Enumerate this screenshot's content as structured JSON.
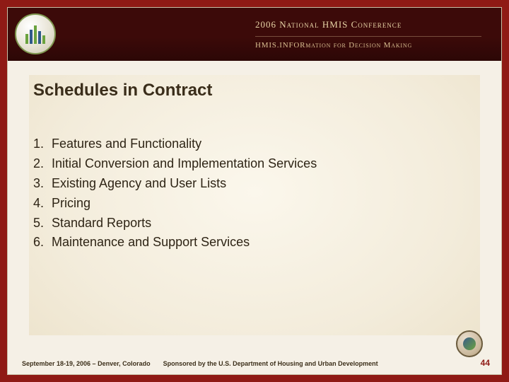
{
  "header": {
    "line1": "2006 National HMIS Conference",
    "line2": "HMIS.INFORmation for Decision Making"
  },
  "title": "Schedules in Contract",
  "items": [
    "Features and Functionality",
    "Initial Conversion and Implementation Services",
    "Existing Agency and User Lists",
    "Pricing",
    "Standard Reports",
    "Maintenance and Support Services"
  ],
  "footer": {
    "left": "September 18-19, 2006 – Denver, Colorado",
    "mid": "Sponsored by the U.S. Department of Housing and Urban Development",
    "page": "44"
  }
}
